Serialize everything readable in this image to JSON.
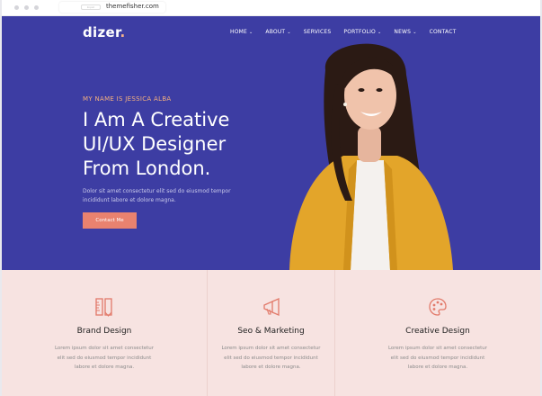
{
  "browser": {
    "tab_pill": "Import",
    "url": "themefisher.com"
  },
  "header": {
    "logo": "dizer",
    "logo_dot": ".",
    "nav": [
      {
        "label": "HOME",
        "chevron": "⌄"
      },
      {
        "label": "ABOUT",
        "chevron": "⌄"
      },
      {
        "label": "SERVICES",
        "chevron": ""
      },
      {
        "label": "PORTFOLIO",
        "chevron": "⌄"
      },
      {
        "label": "NEWS",
        "chevron": "⌄"
      },
      {
        "label": "CONTACT",
        "chevron": ""
      }
    ]
  },
  "hero": {
    "eyebrow": "MY NAME IS JESSICA ALBA",
    "headline_lines": [
      "I Am A Creative",
      "UI/UX Designer",
      "From London."
    ],
    "lead_lines": [
      "Dolor sit amet consectetur elit sed do eiusmod tempor",
      "incididunt labore et dolore magna."
    ],
    "cta": "Contact Me"
  },
  "features": [
    {
      "icon": "pencil-ruler-icon",
      "title": "Brand Design",
      "lines": [
        "Lorem ipsum dolor sit amet consectetur",
        "elit sed do eiusmod tempor incididunt",
        "labore et dolore magna."
      ]
    },
    {
      "icon": "megaphone-icon",
      "title": "Seo & Marketing",
      "lines": [
        "Lorem ipsum dolor sit amet consectetur",
        "elit sed do eiusmod tempor incididunt",
        "labore et dolore magna."
      ]
    },
    {
      "icon": "palette-icon",
      "title": "Creative Design",
      "lines": [
        "Lorem ipsum dolor sit amet consectetur",
        "elit sed do eiusmod tempor incididunt",
        "labore et dolore magna."
      ]
    }
  ],
  "colors": {
    "hero_bg": "#3d3da3",
    "accent": "#e9826f",
    "eyebrow": "#f4b07f",
    "feature_bg": "#f7e3e1"
  }
}
